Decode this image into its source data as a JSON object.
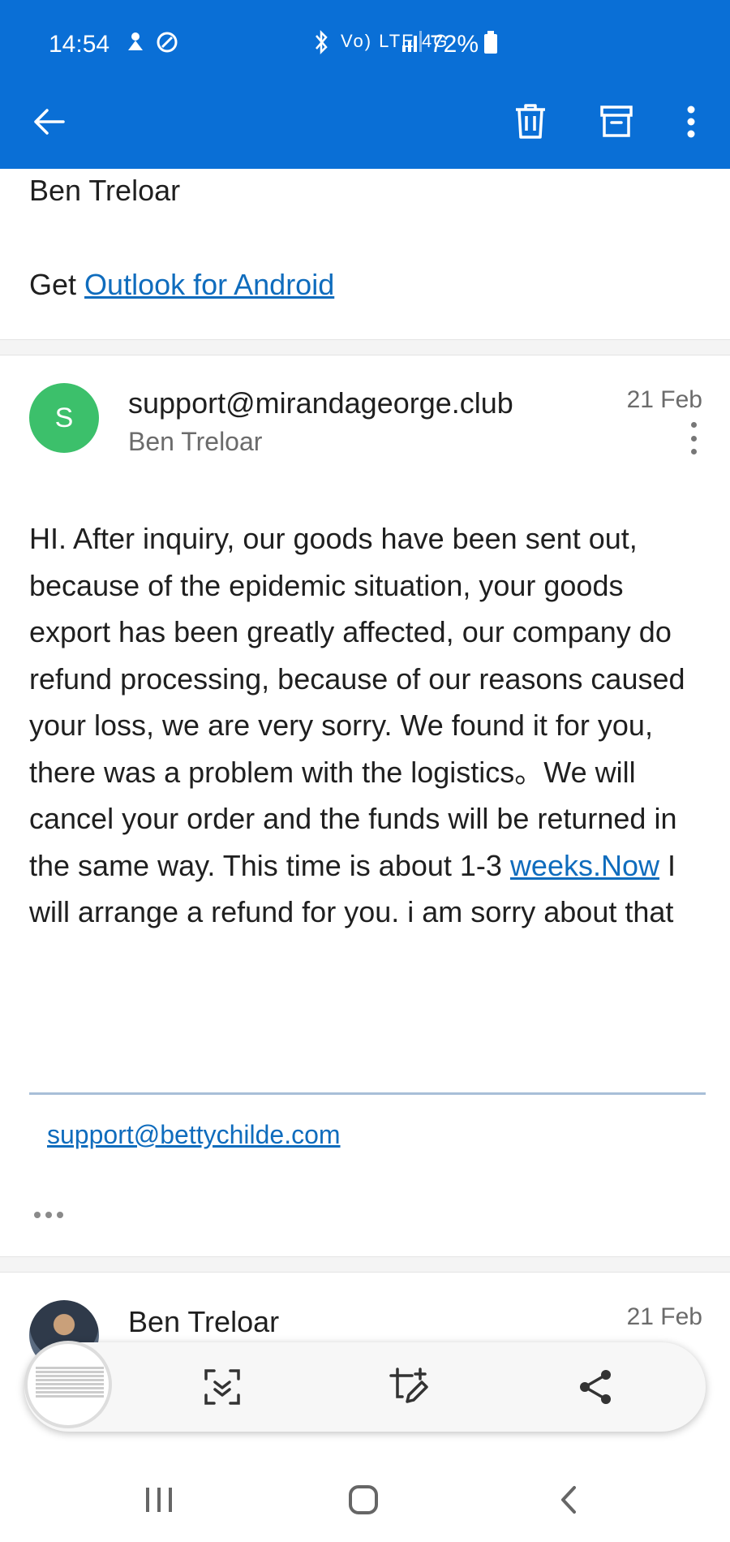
{
  "status_bar": {
    "time": "14:54",
    "network": "Vo) LTE 4G",
    "battery": "72%"
  },
  "toolbar": {
    "icons": [
      "back-arrow-icon",
      "delete-icon",
      "archive-icon",
      "more-vert-icon"
    ]
  },
  "previous_message": {
    "sender_signature": "Ben Treloar",
    "get_prefix": "Get",
    "get_link": "Outlook for Android"
  },
  "message": {
    "avatar_letter": "S",
    "from_email": "support@mirandageorge.club",
    "to_name": "Ben Treloar",
    "date": "21 Feb",
    "body_text": "HI. After inquiry, our goods have been sent out, because of the epidemic situation, your goods export has been greatly affected, our company do refund processing, because of our reasons caused your loss, we are very sorry. We found it for you, there was a problem with the logistics。We will cancel your order and the funds will be returned in the same way. This time is about 1-3 ",
    "body_link": "weeks.Now",
    "body_text_after": " I will arrange a refund for you. i am sorry about that",
    "signature_link": "support@bettychilde.com"
  },
  "next_message": {
    "from_name": "Ben Treloar",
    "date": "21 Feb"
  },
  "capture_toolbar": {
    "icons": [
      "scroll-capture-icon",
      "edit-crop-icon",
      "share-icon"
    ]
  },
  "nav_bar": {
    "icons": [
      "recent-apps-icon",
      "home-icon",
      "back-icon"
    ]
  },
  "colors": {
    "header": "#0a6fd6",
    "link": "#0f6cbd",
    "avatar": "#3cc06b"
  }
}
